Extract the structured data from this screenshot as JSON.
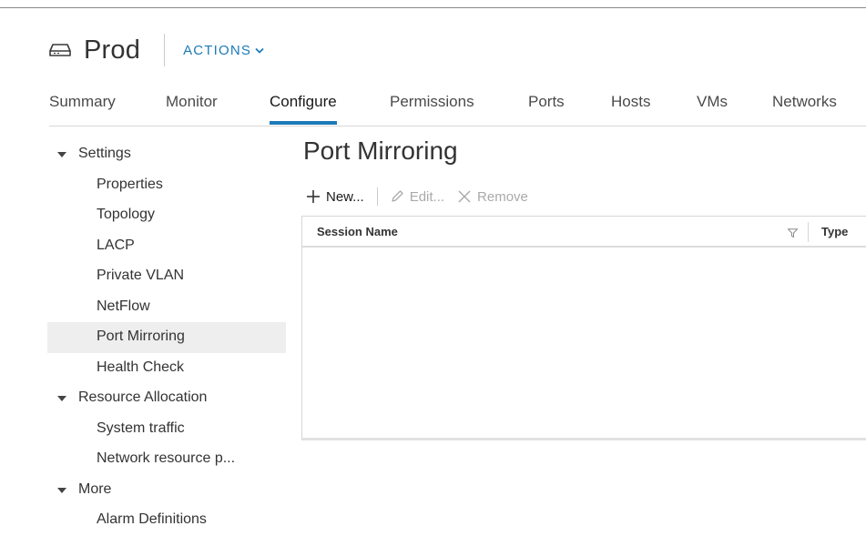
{
  "header": {
    "title": "Prod",
    "actions_label": "ACTIONS"
  },
  "tabs": [
    {
      "label": "Summary",
      "active": false
    },
    {
      "label": "Monitor",
      "active": false
    },
    {
      "label": "Configure",
      "active": true
    },
    {
      "label": "Permissions",
      "active": false
    },
    {
      "label": "Ports",
      "active": false
    },
    {
      "label": "Hosts",
      "active": false
    },
    {
      "label": "VMs",
      "active": false
    },
    {
      "label": "Networks",
      "active": false
    }
  ],
  "sidebar": {
    "items": [
      {
        "label": "Settings",
        "kind": "group",
        "expanded": true
      },
      {
        "label": "Properties",
        "kind": "child"
      },
      {
        "label": "Topology",
        "kind": "child"
      },
      {
        "label": "LACP",
        "kind": "child"
      },
      {
        "label": "Private VLAN",
        "kind": "child"
      },
      {
        "label": "NetFlow",
        "kind": "child"
      },
      {
        "label": "Port Mirroring",
        "kind": "child",
        "selected": true
      },
      {
        "label": "Health Check",
        "kind": "child"
      },
      {
        "label": "Resource Allocation",
        "kind": "group",
        "expanded": true
      },
      {
        "label": "System traffic",
        "kind": "child"
      },
      {
        "label": "Network resource p...",
        "kind": "child"
      },
      {
        "label": "More",
        "kind": "group",
        "expanded": true
      },
      {
        "label": "Alarm Definitions",
        "kind": "child"
      }
    ]
  },
  "main": {
    "title": "Port Mirroring",
    "toolbar": {
      "new_label": "New...",
      "edit_label": "Edit...",
      "remove_label": "Remove"
    },
    "grid": {
      "columns": [
        "Session Name",
        "Type"
      ],
      "rows": []
    }
  },
  "colors": {
    "accent": "#1c7ab8",
    "selected_bg": "#eeeeee",
    "disabled_text": "#aaaaaa"
  },
  "icons": {
    "object": "distributed-switch-icon",
    "actions": "chevron-down-icon",
    "new": "plus-icon",
    "edit": "pencil-icon",
    "remove": "x-icon",
    "filter": "filter-icon",
    "tree": "caret-down-icon"
  }
}
